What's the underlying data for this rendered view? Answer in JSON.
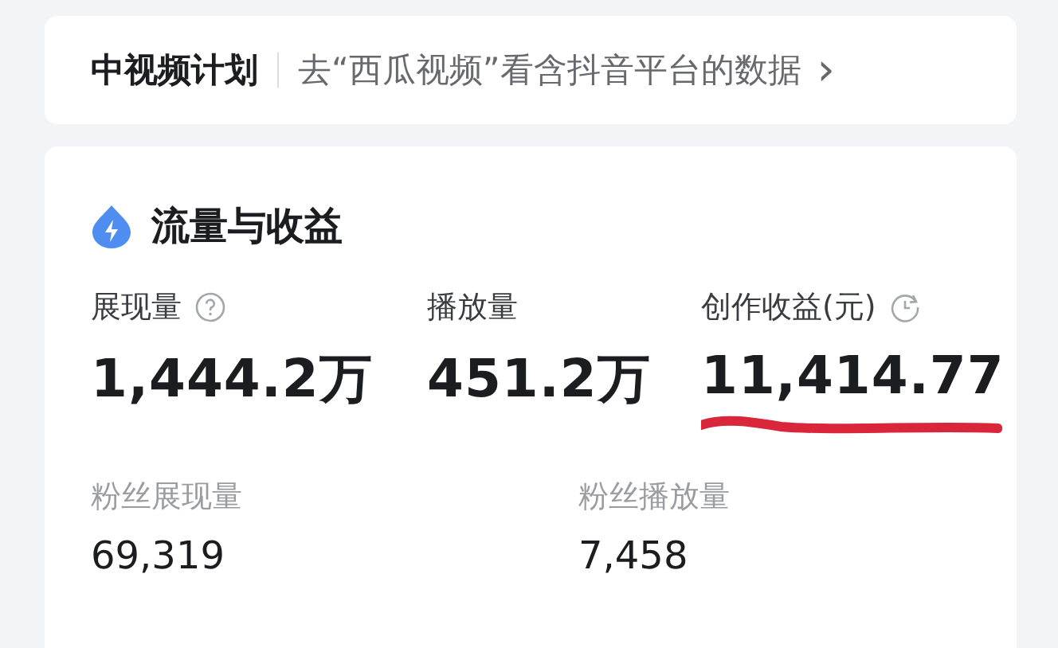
{
  "plan_bar": {
    "title": "中视频计划",
    "link": "去“西瓜视频”看含抖音平台的数据",
    "chevron": "›"
  },
  "section": {
    "title": "流量与收益",
    "metrics": [
      {
        "label": "展现量",
        "value": "1,444.2万",
        "kind": "help",
        "highlighted": false
      },
      {
        "label": "播放量",
        "value": "451.2万",
        "kind": "plain",
        "highlighted": false
      },
      {
        "label": "创作收益(元)",
        "value": "11,414.77",
        "kind": "history",
        "highlighted": true
      }
    ],
    "fan_metrics": [
      {
        "label": "粉丝展现量",
        "value": "69,319"
      },
      {
        "label": "粉丝播放量",
        "value": "7,458"
      }
    ]
  }
}
